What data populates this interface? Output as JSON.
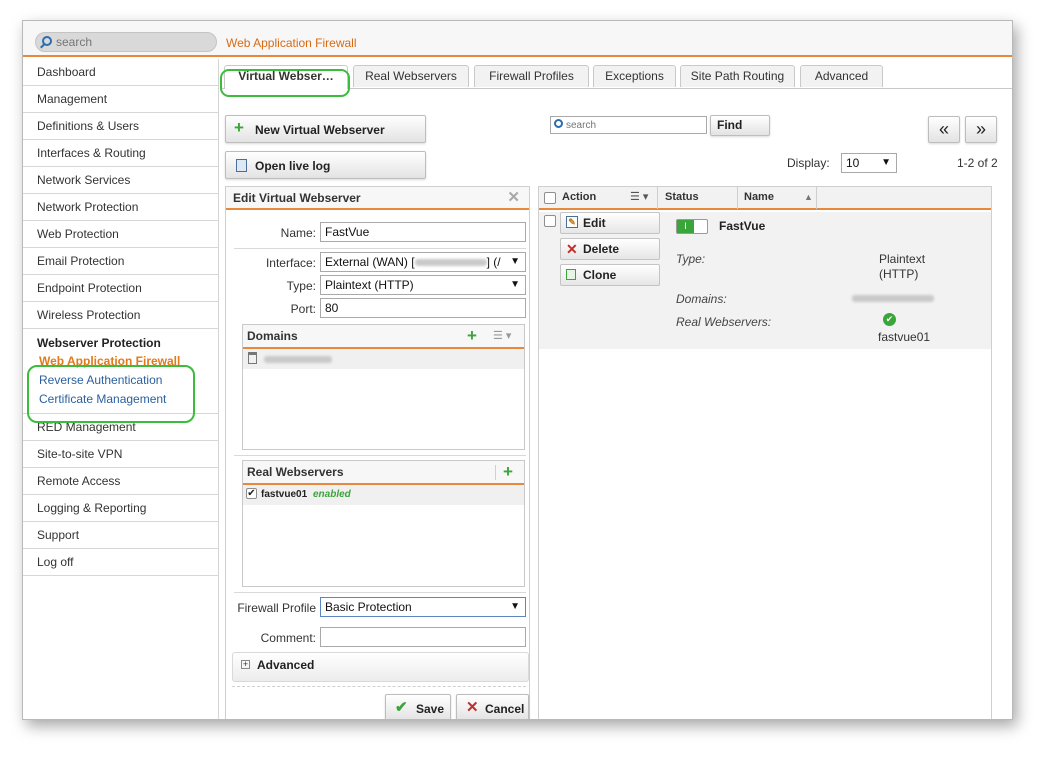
{
  "topbar": {
    "search_placeholder": "search",
    "breadcrumb": "Web Application Firewall"
  },
  "sidebar": {
    "items_top": [
      "Dashboard",
      "Management",
      "Definitions & Users",
      "Interfaces & Routing",
      "Network Services",
      "Network Protection",
      "Web Protection",
      "Email Protection",
      "Endpoint Protection",
      "Wireless Protection"
    ],
    "group_title": "Webserver Protection",
    "group_items": [
      "Web Application Firewall",
      "Reverse Authentication",
      "Certificate Management"
    ],
    "items_bottom": [
      "RED Management",
      "Site-to-site VPN",
      "Remote Access",
      "Logging & Reporting",
      "Support",
      "Log off"
    ]
  },
  "tabs": [
    "Virtual Webser…",
    "Real Webservers",
    "Firewall Profiles",
    "Exceptions",
    "Site Path Routing",
    "Advanced"
  ],
  "toolbar": {
    "new_button": "New Virtual Webserver",
    "log_button": "Open live log",
    "search_placeholder": "search",
    "find_button": "Find",
    "prev_icon": "«",
    "next_icon": "»",
    "display_label": "Display:",
    "display_value": "10",
    "page_count": "1-2 of 2"
  },
  "edit": {
    "title": "Edit Virtual Webserver",
    "name_label": "Name:",
    "name_value": "FastVue",
    "interface_label": "Interface:",
    "interface_value": "External (WAN) [",
    "interface_suffix": "] (/",
    "type_label": "Type:",
    "type_value": "Plaintext (HTTP)",
    "port_label": "Port:",
    "port_value": "80",
    "domains_title": "Domains",
    "real_title": "Real Webservers",
    "real_item": "fastvue01",
    "real_item_status": "enabled",
    "profile_label": "Firewall Profile",
    "profile_value": "Basic Protection",
    "comment_label": "Comment:",
    "comment_value": "",
    "advanced_label": "Advanced",
    "save_button": "Save",
    "cancel_button": "Cancel"
  },
  "list": {
    "col_action": "Action",
    "col_status": "Status",
    "col_name": "Name",
    "edit_button": "Edit",
    "delete_button": "Delete",
    "clone_button": "Clone",
    "entry_name": "FastVue",
    "type_label": "Type:",
    "type_value_line1": "Plaintext",
    "type_value_line2": "(HTTP)",
    "domains_label": "Domains:",
    "real_label": "Real Webservers:",
    "real_value": "fastvue01"
  },
  "colors": {
    "accent": "#e8883a",
    "link": "#2a5f9e",
    "highlight_ring": "#3bbd3b",
    "enabled_green": "#3aa53a"
  }
}
